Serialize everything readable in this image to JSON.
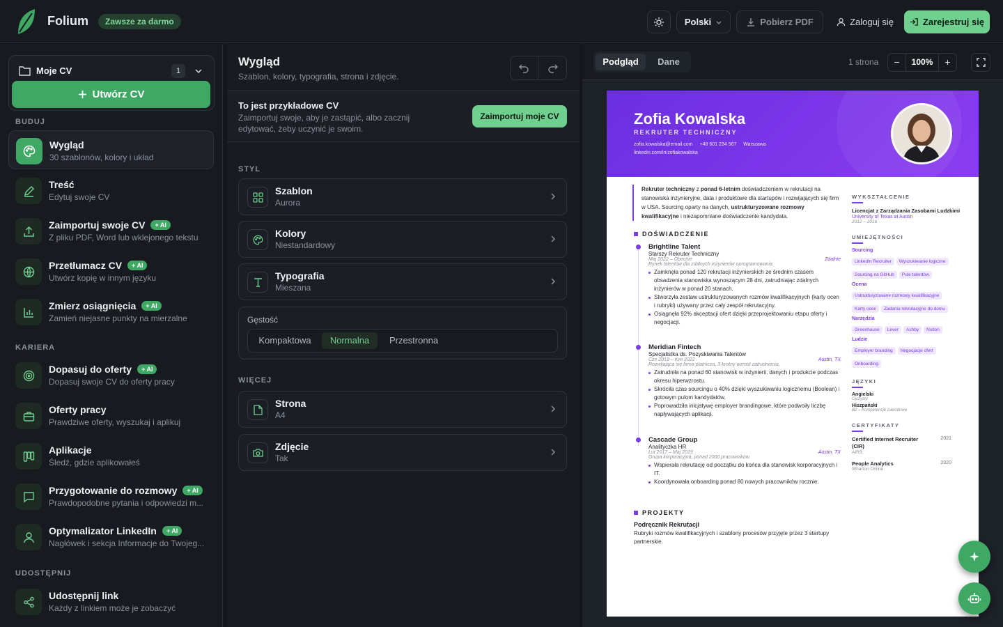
{
  "topbar": {
    "brand": "Folium",
    "badge": "Zawsze za darmo",
    "language": "Polski",
    "download_pdf": "Pobierz PDF",
    "login": "Zaloguj się",
    "register": "Zarejestruj się"
  },
  "sidebar": {
    "my_cv_label": "Moje CV",
    "my_cv_count": "1",
    "create_cv": "Utwórz CV",
    "section_build": "BUDUJ",
    "section_career": "KARIERA",
    "section_share": "UDOSTĘPNIJ",
    "ai_tag": "+ AI",
    "items": [
      {
        "title": "Wygląd",
        "subtitle": "30 szablonów, kolory i układ",
        "icon": "palette-icon",
        "ai": false
      },
      {
        "title": "Treść",
        "subtitle": "Edytuj swoje CV",
        "icon": "pencil-icon",
        "ai": false
      },
      {
        "title": "Zaimportuj swoje CV",
        "subtitle": "Z pliku PDF, Word lub wklejonego tekstu",
        "icon": "upload-icon",
        "ai": true
      },
      {
        "title": "Przetłumacz CV",
        "subtitle": "Utwórz kopię w innym języku",
        "icon": "globe-icon",
        "ai": true
      },
      {
        "title": "Zmierz osiągnięcia",
        "subtitle": "Zamień niejasne punkty na mierzalne",
        "icon": "bar-chart-icon",
        "ai": true
      },
      {
        "title": "Dopasuj do oferty",
        "subtitle": "Dopasuj swoje CV do oferty pracy",
        "icon": "target-icon",
        "ai": true
      },
      {
        "title": "Oferty pracy",
        "subtitle": "Prawdziwe oferty, wyszukaj i aplikuj",
        "icon": "briefcase-icon",
        "ai": false
      },
      {
        "title": "Aplikacje",
        "subtitle": "Śledź, gdzie aplikowałeś",
        "icon": "kanban-icon",
        "ai": false
      },
      {
        "title": "Przygotowanie do rozmowy",
        "subtitle": "Prawdopodobne pytania i odpowiedzi m...",
        "icon": "chat-icon",
        "ai": true
      },
      {
        "title": "Optymalizator LinkedIn",
        "subtitle": "Nagłówek i sekcja Informacje do Twojeg...",
        "icon": "user-icon",
        "ai": true
      },
      {
        "title": "Udostępnij link",
        "subtitle": "Każdy z linkiem może je zobaczyć",
        "icon": "share-icon",
        "ai": false
      }
    ]
  },
  "middle": {
    "title": "Wygląd",
    "subtitle": "Szablon, kolory, typografia, strona i zdjęcie.",
    "notice_title": "To jest przykładowe CV",
    "notice_text": "Zaimportuj swoje, aby je zastąpić, albo zacznij edytować, żeby uczynić je swoim.",
    "notice_button": "Zaimportuj moje CV",
    "section_style": "STYL",
    "section_more": "WIĘCEJ",
    "cards": [
      {
        "title": "Szablon",
        "value": "Aurora",
        "icon": "grid-icon"
      },
      {
        "title": "Kolory",
        "value": "Niestandardowy",
        "icon": "palette-icon"
      },
      {
        "title": "Typografia",
        "value": "Mieszana",
        "icon": "type-icon"
      },
      {
        "title": "Strona",
        "value": "A4",
        "icon": "file-icon"
      },
      {
        "title": "Zdjęcie",
        "value": "Tak",
        "icon": "camera-icon"
      }
    ],
    "density_label": "Gęstość",
    "density_options": [
      "Kompaktowa",
      "Normalna",
      "Przestronna"
    ],
    "density_selected": "Normalna"
  },
  "preview": {
    "tab_preview": "Podgląd",
    "tab_data": "Dane",
    "pages": "1 strona",
    "zoom": "100%"
  },
  "cv": {
    "name": "Zofia Kowalska",
    "role": "REKRUTER TECHNICZNY",
    "email": "zofia.kowalska@email.com",
    "phone": "+48 601 234 567",
    "city": "Warszawa",
    "linkedin": "linkedin.com/in/zofiakowalska",
    "summary_1": "Rekruter techniczny",
    "summary_2": " z ",
    "summary_3": "ponad 6-letnim",
    "summary_4": " doświadczeniem w rekrutacji na stanowiska inżynieryjne, data i produktowe dla startupów i rozwijających się firm w USA. Sourcing oparty na danych, ",
    "summary_5": "ustrukturyzowane rozmowy kwalifikacyjne",
    "summary_6": " i niezapomniane doświadczenie kandydata.",
    "exp_heading": "DOŚWIADCZENIE",
    "jobs": [
      {
        "company": "Brightline Talent",
        "title": "Starszy Rekruter Techniczny",
        "dates": "Maj 2022 – Obecnie",
        "location": "Zdalnie",
        "desc": "Rynek talentów dla zdalnych inżynierów oprogramowania.",
        "bullets": [
          "Zamknęła ponad 120 rekrutacji inżynierskich ze średnim czasem obsadzenia stanowiska wynoszącym 28 dni, zatrudniając zdalnych inżynierów w ponad 20 stanach.",
          "Stworzyła zestaw ustrukturyzowanych rozmów kwalifikacyjnych (karty ocen i rubryki) używany przez cały zespół rekrutacyjny.",
          "Osiągnęła 92% akceptacji ofert dzięki przeprojektowaniu etapu oferty i negocjacji."
        ]
      },
      {
        "company": "Meridian Fintech",
        "title": "Specjalistka ds. Pozyskiwania Talentów",
        "dates": "Cze 2019 – Kwi 2022",
        "location": "Austin, TX",
        "desc": "Rozwijająca się firma płatnicza, 3-krotny wzrost zatrudnienia.",
        "bullets": [
          "Zatrudniła na ponad 60 stanowisk w inżynierii, danych i produkcie podczas okresu hiperwzrostu.",
          "Skróciła czas sourcingu o 40% dzięki wyszukiwaniu logicznemu (Boolean) i gotowym pulom kandydatów.",
          "Poprowadziła inicjatywę employer brandingowe, które podwoiły liczbę napływających aplikacji."
        ]
      },
      {
        "company": "Cascade Group",
        "title": "Analityczka HR",
        "dates": "Lut 2017 – Maj 2019",
        "location": "Austin, TX",
        "desc": "Grupa korporacyjna, ponad 2000 pracowników.",
        "bullets": [
          "Wspierała rekrutację od początku do końca dla stanowisk korporacyjnych i IT.",
          "Koordynowała onboarding ponad 80 nowych pracowników rocznie."
        ]
      }
    ],
    "proj_heading": "PROJEKTY",
    "project_name": "Podręcznik Rekrutacji",
    "project_desc": "Rubryki rozmów kwalifikacyjnych i szablony procesów przyjęte przez 3 startupy partnerskie.",
    "edu_heading": "WYKSZTAŁCENIE",
    "edu_degree": "Licencjat z Zarządzania Zasobami Ludzkimi",
    "edu_school": "University of Texas at Austin",
    "edu_years": "2012 – 2016",
    "skills_heading": "UMIEJĘTNOŚCI",
    "skill_groups": [
      {
        "name": "Sourcing",
        "tags": [
          "LinkedIn Recruiter",
          "Wyszukiwanie logiczne",
          "Sourcing na GitHub",
          "Pule talentów"
        ]
      },
      {
        "name": "Ocena",
        "tags": [
          "Ustrukturyzowane rozmowy kwalifikacyjne",
          "Karty ocen",
          "Zadania rekrutacyjne do domu"
        ]
      },
      {
        "name": "Narzędzia",
        "tags": [
          "Greenhouse",
          "Lever",
          "Ashby",
          "Notion"
        ]
      },
      {
        "name": "Ludzie",
        "tags": [
          "Employer branding",
          "Negocjacje ofert",
          "Onboarding"
        ]
      }
    ],
    "lang_heading": "JĘZYKI",
    "languages": [
      {
        "name": "Angielski",
        "level": "Ojczysty"
      },
      {
        "name": "Hiszpański",
        "level": "B2 – Kompetencje zawodowe"
      }
    ],
    "cert_heading": "CERTYFIKATY",
    "certs": [
      {
        "name": "Certified Internet Recruiter (CIR)",
        "issuer": "AIRS",
        "year": "2021"
      },
      {
        "name": "People Analytics",
        "issuer": "Wharton Online",
        "year": "2020"
      }
    ]
  },
  "colors": {
    "accent_green": "#3ea864",
    "cv_purple": "#7a3be8",
    "background": "#13161b"
  }
}
